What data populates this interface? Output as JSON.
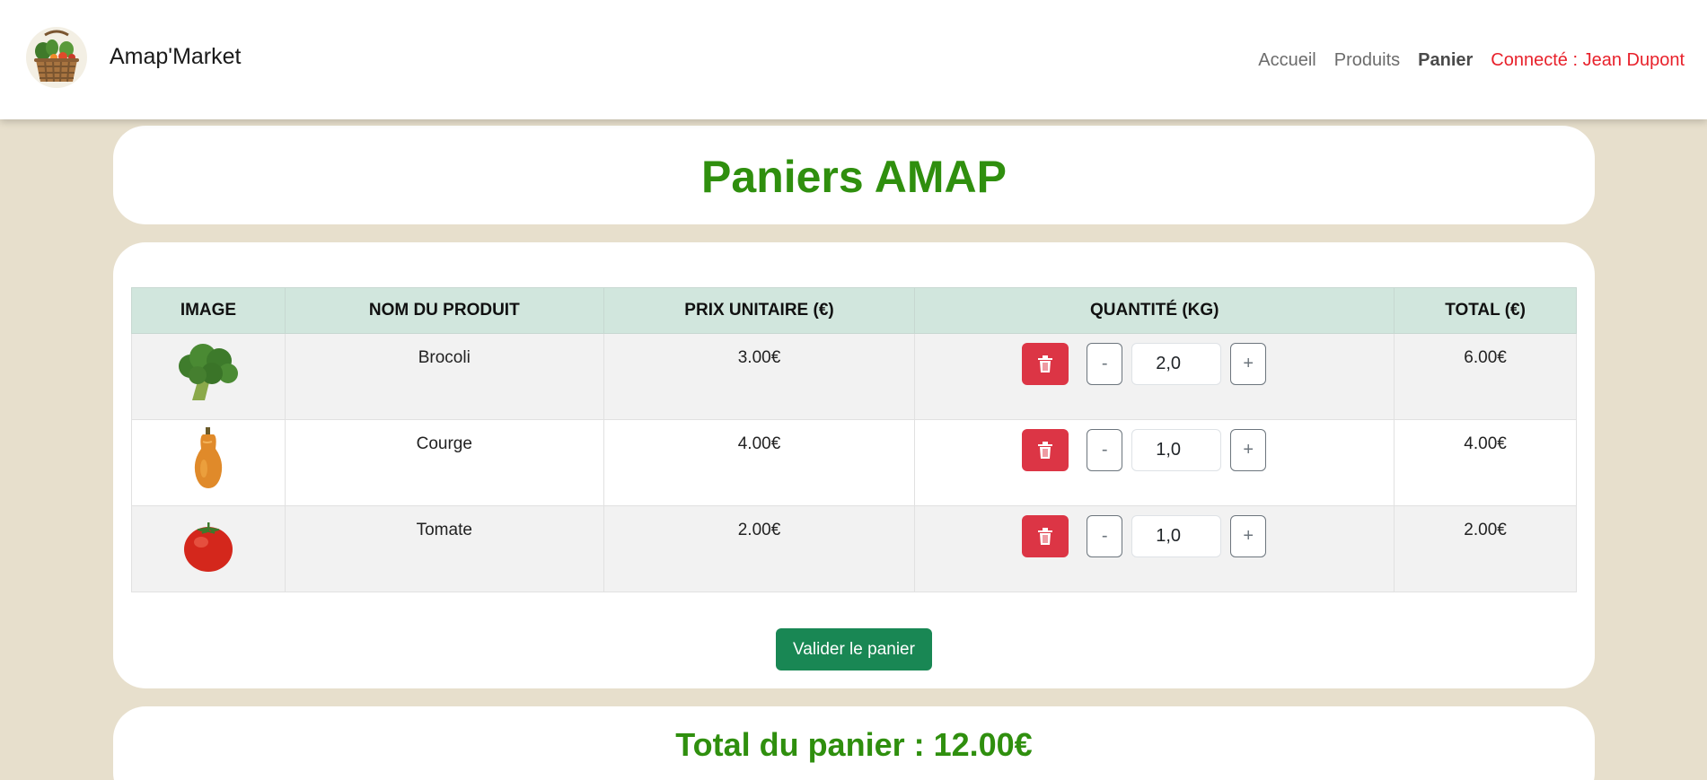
{
  "nav": {
    "brand": "Amap'Market",
    "links": [
      "Accueil",
      "Produits",
      "Panier"
    ],
    "user": "Connecté : Jean Dupont"
  },
  "page": {
    "title": "Paniers AMAP"
  },
  "table": {
    "headers": [
      "IMAGE",
      "NOM DU PRODUIT",
      "PRIX UNITAIRE (€)",
      "QUANTITÉ (KG)",
      "TOTAL (€)"
    ],
    "rows": [
      {
        "icon": "broccoli-image",
        "name": "Brocoli",
        "price": "3.00€",
        "qty": "2,0",
        "total": "6.00€"
      },
      {
        "icon": "squash-image",
        "name": "Courge",
        "price": "4.00€",
        "qty": "1,0",
        "total": "4.00€"
      },
      {
        "icon": "tomato-image",
        "name": "Tomate",
        "price": "2.00€",
        "qty": "1,0",
        "total": "2.00€"
      }
    ],
    "minus": "-",
    "plus": "+"
  },
  "validate_label": "Valider le panier",
  "total_label": "Total du panier : 12.00€",
  "colors": {
    "accent": "#2f8f0e",
    "danger": "#dc3545",
    "success": "#198754",
    "background": "#e7dfcc",
    "header": "#d1e6dd"
  }
}
